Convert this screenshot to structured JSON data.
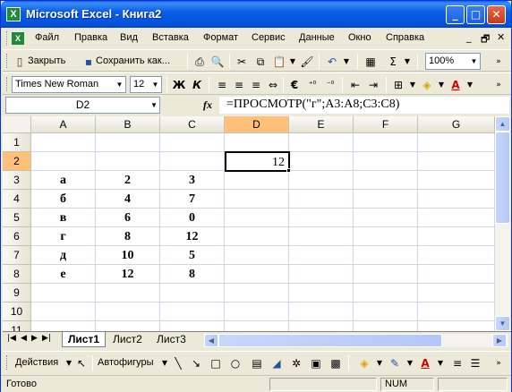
{
  "window": {
    "title": "Microsoft Excel - Книга2",
    "minimize": "_",
    "maximize": "□",
    "close": "✕"
  },
  "menu": {
    "items": [
      "Файл",
      "Правка",
      "Вид",
      "Вставка",
      "Формат",
      "Сервис",
      "Данные",
      "Окно",
      "Справка"
    ],
    "doc_min": "_",
    "doc_restore": "🗗",
    "doc_close": "✕"
  },
  "toolbar1": {
    "close_label": "Закрыть",
    "save_as_label": "Сохранить как...",
    "zoom_value": "100%"
  },
  "toolbar2": {
    "font_name": "Times New Roman",
    "font_size": "12",
    "bold": "Ж",
    "italic": "К"
  },
  "formula_bar": {
    "name_box": "D2",
    "fx": "fx",
    "formula": "=ПРОСМОТР(\"г\";A3:A8;C3:C8)"
  },
  "grid": {
    "columns": [
      "A",
      "B",
      "C",
      "D",
      "E",
      "F",
      "G"
    ],
    "selected_column": "D",
    "rows": [
      "1",
      "2",
      "3",
      "4",
      "5",
      "6",
      "7",
      "8",
      "9",
      "10",
      "11"
    ],
    "selected_row": "2",
    "active_cell_value": "12",
    "data": [
      [
        "а",
        "2",
        "3"
      ],
      [
        "б",
        "4",
        "7"
      ],
      [
        "в",
        "6",
        "0"
      ],
      [
        "г",
        "8",
        "12"
      ],
      [
        "д",
        "10",
        "5"
      ],
      [
        "е",
        "12",
        "8"
      ]
    ]
  },
  "sheet_tabs": [
    "Лист1",
    "Лист2",
    "Лист3"
  ],
  "drawing_toolbar": {
    "actions_label": "Действия",
    "autoshapes_label": "Автофигуры"
  },
  "status": {
    "ready": "Готово",
    "num": "NUM"
  }
}
